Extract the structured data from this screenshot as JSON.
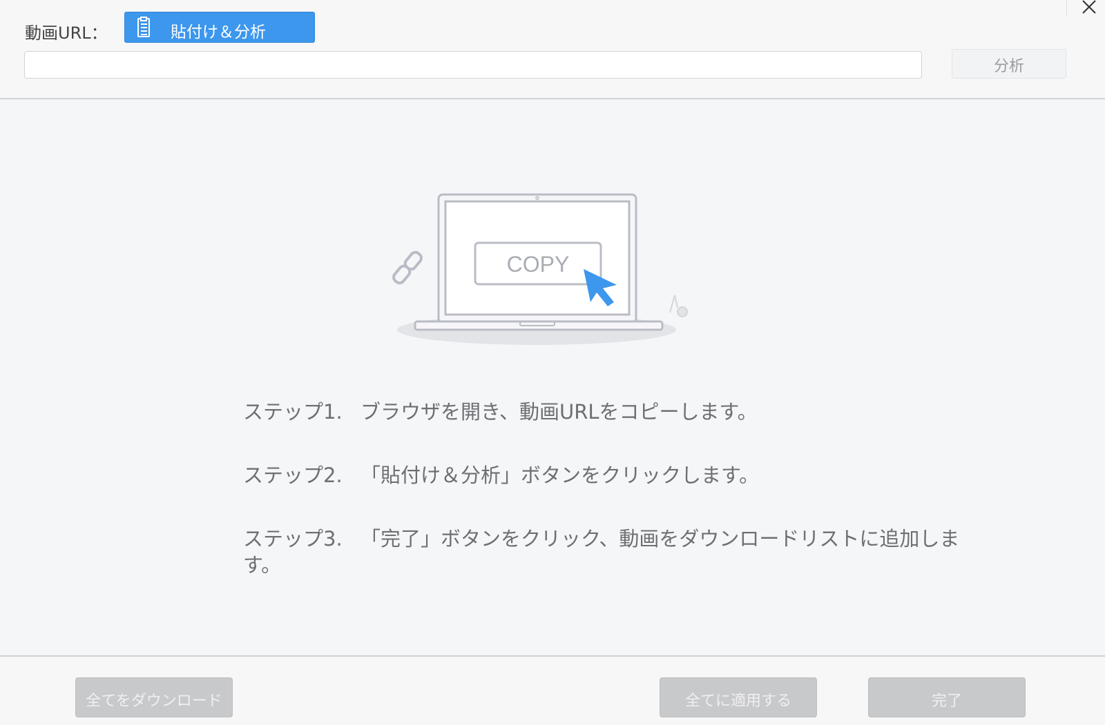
{
  "header": {
    "url_label": "動画URL：",
    "paste_button_label": "貼付け＆分析",
    "url_input_value": "",
    "url_input_placeholder": "",
    "analyze_button_label": "分析"
  },
  "illustration": {
    "copy_text": "COPY"
  },
  "steps": [
    {
      "num": "ステップ1.",
      "text": "ブラウザを開き、動画URLをコピーします。"
    },
    {
      "num": "ステップ2.",
      "text": "「貼付け＆分析」ボタンをクリックします。"
    },
    {
      "num": "ステップ3.",
      "text": "「完了」ボタンをクリック、動画をダウンロードリストに追加します。"
    }
  ],
  "footer": {
    "download_all_label": "全てをダウンロード",
    "apply_all_label": "全てに適用する",
    "done_label": "完了"
  },
  "colors": {
    "accent": "#3d97ec",
    "disabled_button": "#c8c9cb"
  }
}
